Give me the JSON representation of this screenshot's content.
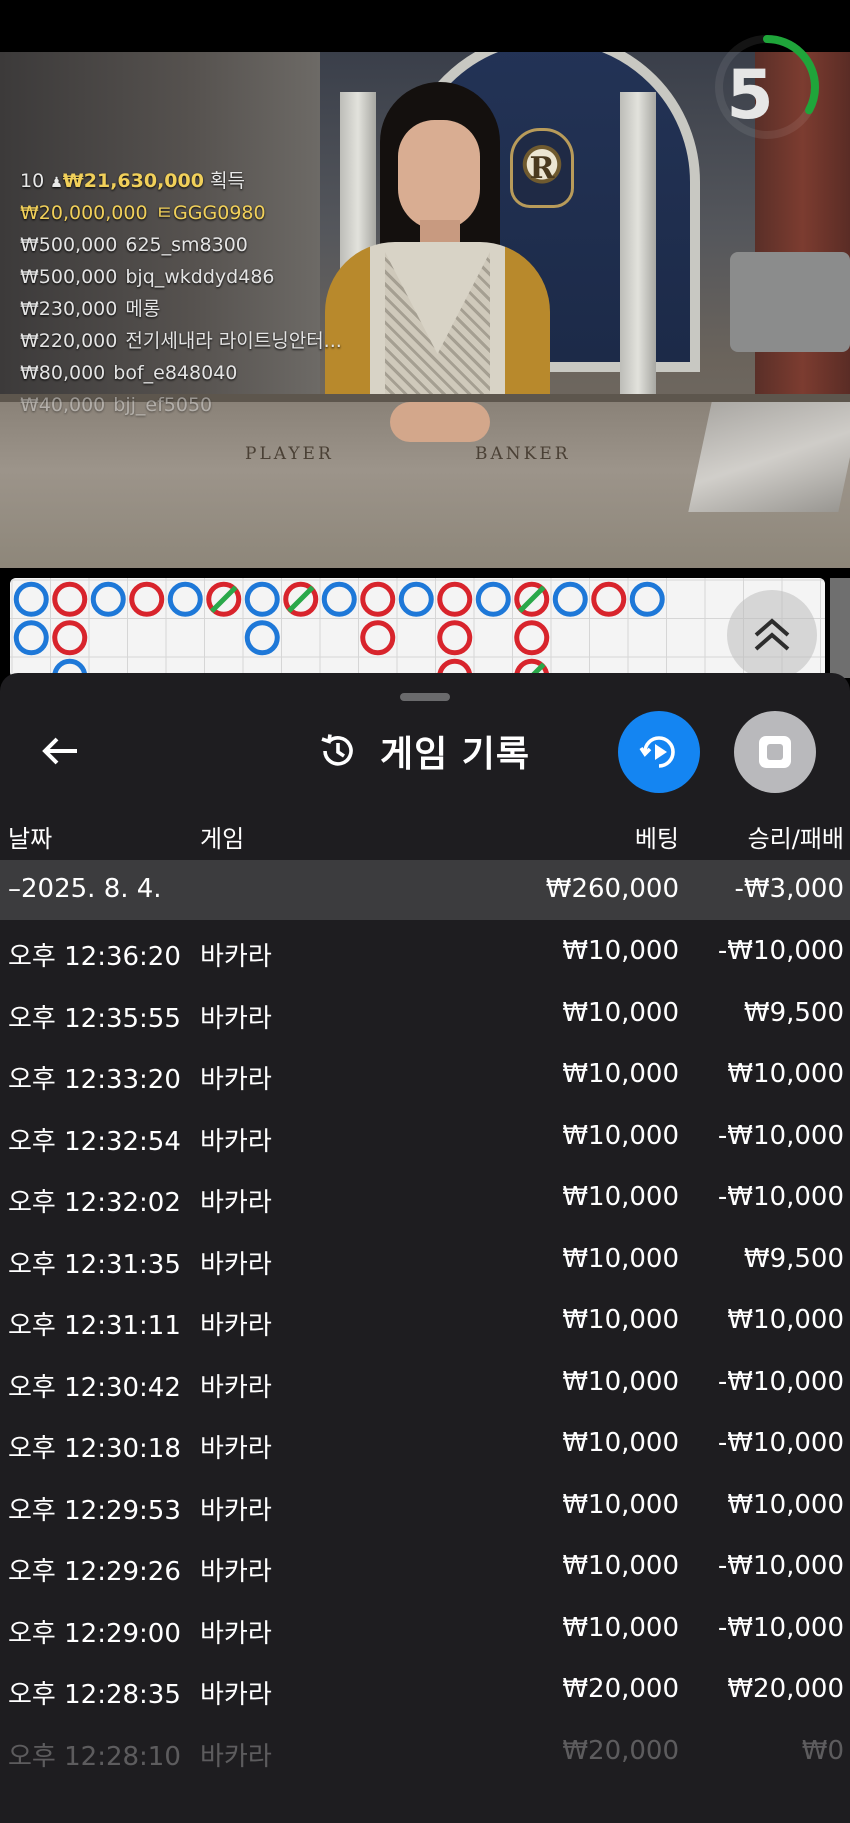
{
  "timer": {
    "value": "5",
    "progress": 0.33
  },
  "winners": {
    "count": "10",
    "total": "₩21,630,000",
    "suffix": "획득",
    "list": [
      {
        "amount": "₩20,000,000",
        "name": "ㅌGGG0980"
      },
      {
        "amount": "₩500,000",
        "name": "625_sm8300"
      },
      {
        "amount": "₩500,000",
        "name": "bjq_wkddyd486"
      },
      {
        "amount": "₩230,000",
        "name": "메롱"
      },
      {
        "amount": "₩220,000",
        "name": "전기세내라 라이트닝안터..."
      },
      {
        "amount": "₩80,000",
        "name": "bof_e848040"
      },
      {
        "amount": "₩40,000",
        "name": "bjj_ef5050"
      }
    ]
  },
  "table": {
    "player_label": "PLAYER",
    "banker_label": "BANKER",
    "emblem": "R"
  },
  "road": {
    "colors": {
      "player": "#1e78d8",
      "banker": "#d8242c",
      "tie": "#2aa84a"
    },
    "columns": [
      [
        "P",
        "P"
      ],
      [
        "B",
        "B",
        "P"
      ],
      [
        "P"
      ],
      [
        "B"
      ],
      [
        "P"
      ],
      [
        "B-tie"
      ],
      [
        "P",
        "P"
      ],
      [
        "B-tie"
      ],
      [
        "P"
      ],
      [
        "B",
        "B"
      ],
      [
        "P"
      ],
      [
        "B",
        "B",
        "B"
      ],
      [
        "P"
      ],
      [
        "B-tie",
        "B",
        "B-tie"
      ],
      [
        "P"
      ],
      [
        "B"
      ],
      [
        "P"
      ]
    ]
  },
  "panel": {
    "title": "게임 기록",
    "columns": {
      "date": "날짜",
      "game": "게임",
      "bet": "베팅",
      "result": "승리/패배"
    },
    "summary": {
      "date": "–2025. 8. 4.",
      "bet": "₩260,000",
      "result": "-₩3,000"
    },
    "rows": [
      {
        "time": "오후 12:36:20",
        "game": "바카라",
        "bet": "₩10,000",
        "result": "-₩10,000"
      },
      {
        "time": "오후 12:35:55",
        "game": "바카라",
        "bet": "₩10,000",
        "result": "₩9,500"
      },
      {
        "time": "오후 12:33:20",
        "game": "바카라",
        "bet": "₩10,000",
        "result": "₩10,000"
      },
      {
        "time": "오후 12:32:54",
        "game": "바카라",
        "bet": "₩10,000",
        "result": "-₩10,000"
      },
      {
        "time": "오후 12:32:02",
        "game": "바카라",
        "bet": "₩10,000",
        "result": "-₩10,000"
      },
      {
        "time": "오후 12:31:35",
        "game": "바카라",
        "bet": "₩10,000",
        "result": "₩9,500"
      },
      {
        "time": "오후 12:31:11",
        "game": "바카라",
        "bet": "₩10,000",
        "result": "₩10,000"
      },
      {
        "time": "오후 12:30:42",
        "game": "바카라",
        "bet": "₩10,000",
        "result": "-₩10,000"
      },
      {
        "time": "오후 12:30:18",
        "game": "바카라",
        "bet": "₩10,000",
        "result": "-₩10,000"
      },
      {
        "time": "오후 12:29:53",
        "game": "바카라",
        "bet": "₩10,000",
        "result": "₩10,000"
      },
      {
        "time": "오후 12:29:26",
        "game": "바카라",
        "bet": "₩10,000",
        "result": "-₩10,000"
      },
      {
        "time": "오후 12:29:00",
        "game": "바카라",
        "bet": "₩10,000",
        "result": "-₩10,000"
      },
      {
        "time": "오후 12:28:35",
        "game": "바카라",
        "bet": "₩20,000",
        "result": "₩20,000"
      },
      {
        "time": "오후 12:28:10",
        "game": "바카라",
        "bet": "₩20,000",
        "result": "₩0"
      }
    ]
  },
  "icons": {
    "back": "arrow-left-icon",
    "history": "history-clock-icon",
    "replay": "replay-play-icon",
    "stop": "stop-square-icon",
    "expand": "chevron-double-up-icon"
  }
}
